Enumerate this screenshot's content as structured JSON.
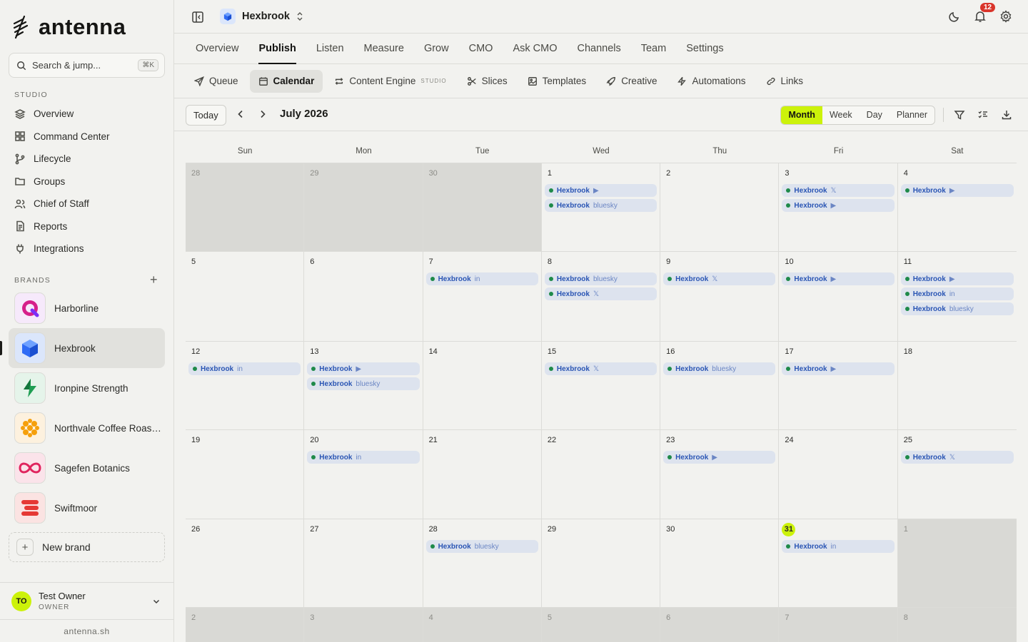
{
  "sidebar": {
    "logo_text": "antenna",
    "search": {
      "placeholder": "Search & jump...",
      "shortcut": "⌘K"
    },
    "studio_label": "STUDIO",
    "nav": [
      {
        "label": "Overview",
        "icon": "layers-icon"
      },
      {
        "label": "Command Center",
        "icon": "grid-icon"
      },
      {
        "label": "Lifecycle",
        "icon": "branch-icon"
      },
      {
        "label": "Groups",
        "icon": "folder-icon"
      },
      {
        "label": "Chief of Staff",
        "icon": "users-icon"
      },
      {
        "label": "Reports",
        "icon": "document-icon"
      },
      {
        "label": "Integrations",
        "icon": "plug-icon"
      }
    ],
    "brands_label": "BRANDS",
    "add_brand_icon": "+",
    "brands": [
      {
        "name": "Harborline",
        "color": "#7b2ff7"
      },
      {
        "name": "Hexbrook",
        "color": "#2f6bf5",
        "active": true
      },
      {
        "name": "Ironpine Strength",
        "color": "#1f9e53"
      },
      {
        "name": "Northvale Coffee Roasters",
        "color": "#f59f0b"
      },
      {
        "name": "Sagefen Botanics",
        "color": "#e0245e"
      },
      {
        "name": "Swiftmoor",
        "color": "#e53935"
      }
    ],
    "new_brand_label": "New brand",
    "user": {
      "initials": "TO",
      "name": "Test Owner",
      "role": "OWNER"
    },
    "footer": "antenna.sh"
  },
  "topbar": {
    "workspace": "Hexbrook",
    "notification_count": "12"
  },
  "main_tabs": [
    {
      "label": "Overview"
    },
    {
      "label": "Publish",
      "active": true
    },
    {
      "label": "Listen"
    },
    {
      "label": "Measure"
    },
    {
      "label": "Grow"
    },
    {
      "label": "CMO"
    },
    {
      "label": "Ask CMO"
    },
    {
      "label": "Channels"
    },
    {
      "label": "Team"
    },
    {
      "label": "Settings"
    }
  ],
  "sub_tabs": [
    {
      "label": "Queue",
      "icon": "send-icon"
    },
    {
      "label": "Calendar",
      "icon": "calendar-icon",
      "active": true
    },
    {
      "label": "Content Engine",
      "icon": "repeat-icon",
      "tag": "STUDIO"
    },
    {
      "label": "Slices",
      "icon": "scissors-icon"
    },
    {
      "label": "Templates",
      "icon": "image-icon"
    },
    {
      "label": "Creative",
      "icon": "rocket-icon"
    },
    {
      "label": "Automations",
      "icon": "bolt-icon"
    },
    {
      "label": "Links",
      "icon": "link-icon"
    }
  ],
  "toolbar": {
    "today_label": "Today",
    "month_label": "July 2026",
    "views": [
      {
        "label": "Month",
        "active": true
      },
      {
        "label": "Week"
      },
      {
        "label": "Day"
      },
      {
        "label": "Planner"
      }
    ]
  },
  "calendar": {
    "weekdays": [
      "Sun",
      "Mon",
      "Tue",
      "Wed",
      "Thu",
      "Fri",
      "Sat"
    ],
    "today": "31",
    "days": [
      {
        "d": "28",
        "out": true,
        "events": []
      },
      {
        "d": "29",
        "out": true,
        "events": []
      },
      {
        "d": "30",
        "out": true,
        "events": []
      },
      {
        "d": "1",
        "events": [
          {
            "b": "Hexbrook",
            "c": "▶"
          },
          {
            "b": "Hexbrook",
            "c": "bluesky"
          }
        ]
      },
      {
        "d": "2",
        "events": []
      },
      {
        "d": "3",
        "events": [
          {
            "b": "Hexbrook",
            "c": "𝕏"
          },
          {
            "b": "Hexbrook",
            "c": "▶"
          }
        ]
      },
      {
        "d": "4",
        "events": [
          {
            "b": "Hexbrook",
            "c": "▶"
          }
        ]
      },
      {
        "d": "5",
        "events": []
      },
      {
        "d": "6",
        "events": []
      },
      {
        "d": "7",
        "events": [
          {
            "b": "Hexbrook",
            "c": "in"
          }
        ]
      },
      {
        "d": "8",
        "events": [
          {
            "b": "Hexbrook",
            "c": "bluesky"
          },
          {
            "b": "Hexbrook",
            "c": "𝕏"
          }
        ]
      },
      {
        "d": "9",
        "events": [
          {
            "b": "Hexbrook",
            "c": "𝕏"
          }
        ]
      },
      {
        "d": "10",
        "events": [
          {
            "b": "Hexbrook",
            "c": "▶"
          }
        ]
      },
      {
        "d": "11",
        "events": [
          {
            "b": "Hexbrook",
            "c": "▶"
          },
          {
            "b": "Hexbrook",
            "c": "in"
          },
          {
            "b": "Hexbrook",
            "c": "bluesky"
          }
        ]
      },
      {
        "d": "12",
        "events": [
          {
            "b": "Hexbrook",
            "c": "in"
          }
        ]
      },
      {
        "d": "13",
        "events": [
          {
            "b": "Hexbrook",
            "c": "▶"
          },
          {
            "b": "Hexbrook",
            "c": "bluesky"
          }
        ]
      },
      {
        "d": "14",
        "events": []
      },
      {
        "d": "15",
        "events": [
          {
            "b": "Hexbrook",
            "c": "𝕏"
          }
        ]
      },
      {
        "d": "16",
        "events": [
          {
            "b": "Hexbrook",
            "c": "bluesky"
          }
        ]
      },
      {
        "d": "17",
        "events": [
          {
            "b": "Hexbrook",
            "c": "▶"
          }
        ]
      },
      {
        "d": "18",
        "events": []
      },
      {
        "d": "19",
        "events": []
      },
      {
        "d": "20",
        "events": [
          {
            "b": "Hexbrook",
            "c": "in"
          }
        ]
      },
      {
        "d": "21",
        "events": []
      },
      {
        "d": "22",
        "events": []
      },
      {
        "d": "23",
        "events": [
          {
            "b": "Hexbrook",
            "c": "▶"
          }
        ]
      },
      {
        "d": "24",
        "events": []
      },
      {
        "d": "25",
        "events": [
          {
            "b": "Hexbrook",
            "c": "𝕏"
          }
        ]
      },
      {
        "d": "26",
        "events": []
      },
      {
        "d": "27",
        "events": []
      },
      {
        "d": "28",
        "events": [
          {
            "b": "Hexbrook",
            "c": "bluesky"
          }
        ]
      },
      {
        "d": "29",
        "events": []
      },
      {
        "d": "30",
        "events": []
      },
      {
        "d": "31",
        "today": true,
        "events": [
          {
            "b": "Hexbrook",
            "c": "in"
          }
        ]
      },
      {
        "d": "1",
        "out": true,
        "events": []
      },
      {
        "d": "2",
        "out": true,
        "events": []
      },
      {
        "d": "3",
        "out": true,
        "events": []
      },
      {
        "d": "4",
        "out": true,
        "events": []
      },
      {
        "d": "5",
        "out": true,
        "events": []
      },
      {
        "d": "6",
        "out": true,
        "events": []
      },
      {
        "d": "7",
        "out": true,
        "events": []
      },
      {
        "d": "8",
        "out": true,
        "events": []
      }
    ]
  },
  "colors": {
    "accent": "#ccf20a",
    "event_bg": "#dde3ee",
    "event_text": "#2a55b4",
    "badge": "#d9352b"
  }
}
